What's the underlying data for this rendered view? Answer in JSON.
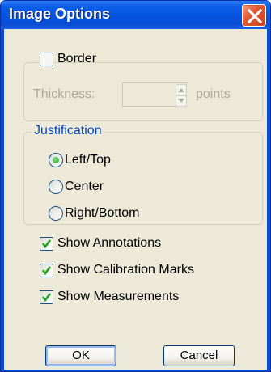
{
  "window": {
    "title": "Image Options",
    "close_icon": "close-icon"
  },
  "border_group": {
    "checkbox_label": "Border",
    "checked": false,
    "thickness_label": "Thickness:",
    "thickness_value": "",
    "unit_label": "points"
  },
  "justification": {
    "legend": "Justification",
    "options": [
      {
        "label": "Left/Top",
        "selected": true
      },
      {
        "label": "Center",
        "selected": false
      },
      {
        "label": "Right/Bottom",
        "selected": false
      }
    ]
  },
  "options": [
    {
      "label": "Show Annotations",
      "checked": true
    },
    {
      "label": "Show Calibration Marks",
      "checked": true
    },
    {
      "label": "Show Measurements",
      "checked": true
    }
  ],
  "buttons": {
    "ok": "OK",
    "cancel": "Cancel"
  },
  "colors": {
    "title_bar": "#0a4ad8",
    "close_button": "#e45a32",
    "dialog_face": "#ece9d8",
    "group_legend": "#0046d5",
    "check_mark": "#21a121",
    "disabled_text": "#aca899"
  }
}
